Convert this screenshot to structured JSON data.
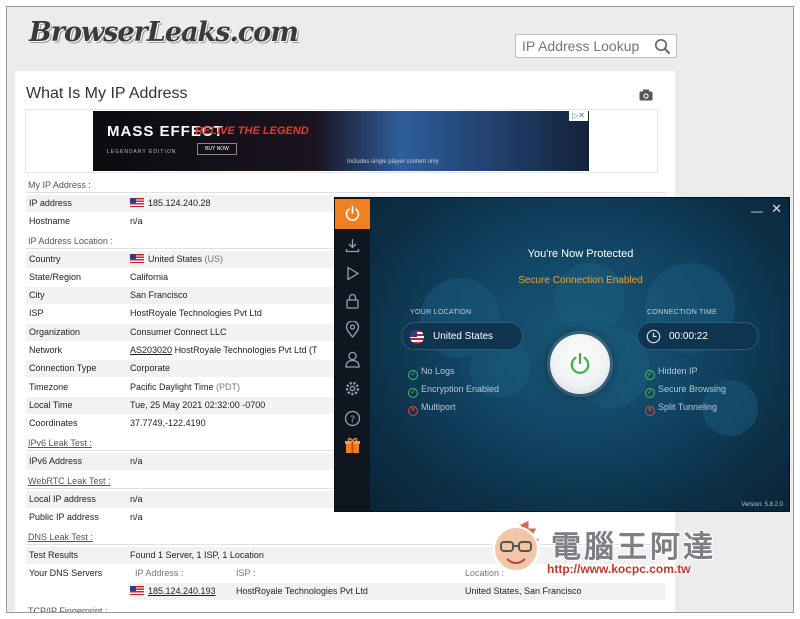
{
  "site": {
    "logo_text": "BrowserLeaks.com",
    "search_placeholder": "IP Address Lookup"
  },
  "page": {
    "title": "What Is My IP Address"
  },
  "ad": {
    "brand": "MASS EFFECT",
    "edition": "LEGENDARY EDITION",
    "headline": "RELIVE THE LEGEND",
    "cta": "BUY NOW",
    "fine_print": "Includes single player content only",
    "close": "▷✕"
  },
  "sections": {
    "my_ip": "My IP Address :",
    "ip_location": "IP Address Location :",
    "ipv6": "IPv6 Leak Test :",
    "webrtc": "WebRTC Leak Test :",
    "dns": "DNS Leak Test :",
    "tcpip": "TCP/IP Fingerprint :"
  },
  "rows": {
    "ip_address": {
      "k": "IP address",
      "v": "185.124.240.28"
    },
    "hostname": {
      "k": "Hostname",
      "v": "n/a"
    },
    "country": {
      "k": "Country",
      "v": "United States",
      "code": "(US)"
    },
    "state": {
      "k": "State/Region",
      "v": "California"
    },
    "city": {
      "k": "City",
      "v": "San Francisco"
    },
    "isp": {
      "k": "ISP",
      "v": "HostRoyale Technologies Pvt Ltd"
    },
    "org": {
      "k": "Organization",
      "v": "Consumer Connect LLC"
    },
    "network": {
      "k": "Network",
      "asn": "AS203020",
      "v": "HostRoyale Technologies Pvt Ltd (T"
    },
    "conn": {
      "k": "Connection Type",
      "v": "Corporate"
    },
    "tz": {
      "k": "Timezone",
      "v": "Pacific Daylight Time",
      "code": "(PDT)"
    },
    "local_time": {
      "k": "Local Time",
      "v": "Tue, 25 May 2021 02:32:00 -0700"
    },
    "coords": {
      "k": "Coordinates",
      "v": "37.7749,-122.4190"
    },
    "ipv6_addr": {
      "k": "IPv6 Address",
      "v": "n/a"
    },
    "local_ip": {
      "k": "Local IP address",
      "v": "n/a"
    },
    "public_ip": {
      "k": "Public IP address",
      "v": "n/a"
    },
    "dns_results": {
      "k": "Test Results",
      "v": "Found 1 Server, 1 ISP, 1 Location"
    },
    "dns_servers": {
      "k": "Your DNS Servers"
    }
  },
  "dns_table": {
    "headers": [
      "IP Address :",
      "ISP :",
      "Location :"
    ],
    "ip": "185.124.240.193",
    "isp": "HostRoyale Technologies Pvt Ltd",
    "location": "United States, San Francisco"
  },
  "vpn": {
    "minimize": "—",
    "close": "✕",
    "status": "You're Now Protected",
    "sub_status": "Secure Connection Enabled",
    "location_label": "YOUR LOCATION",
    "location": "United States",
    "time_label": "CONNECTION TIME",
    "time": "00:00:22",
    "features_left": [
      {
        "label": "No Logs",
        "state": "on"
      },
      {
        "label": "Encryption Enabled",
        "state": "on"
      },
      {
        "label": "Multiport",
        "state": "off"
      }
    ],
    "features_right": [
      {
        "label": "Hidden IP",
        "state": "on"
      },
      {
        "label": "Secure Browsing",
        "state": "on"
      },
      {
        "label": "Split Tunneling",
        "state": "off"
      }
    ],
    "version": "Version: 5.8.2.0",
    "accent": "#f07f22",
    "ok_color": "#4cba58",
    "off_color": "#e2493c"
  },
  "watermark": {
    "text": "電腦王阿達",
    "url": "http://www.kocpc.com.tw"
  }
}
